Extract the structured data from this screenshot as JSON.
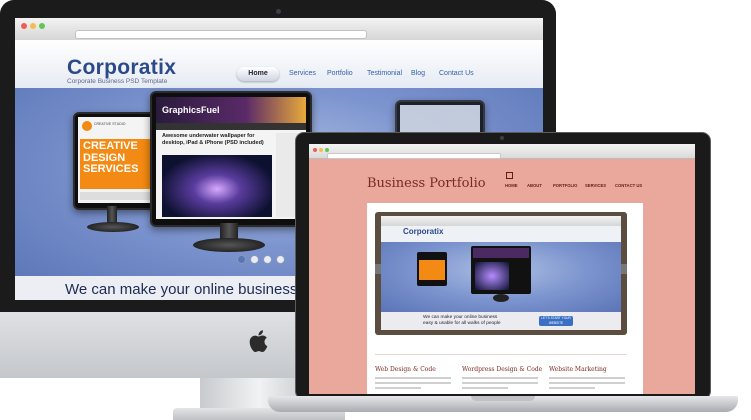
{
  "imac_site": {
    "logo": "Corporatix",
    "tagline": "Corporate Business PSD Template",
    "nav": [
      "Home",
      "Services",
      "Portfolio",
      "Testimonial",
      "Blog",
      "Contact Us"
    ],
    "active_nav": "Home",
    "hero_text": "We can make your online business",
    "left_monitor": {
      "badge": "CREATIVE STUDIO",
      "headline_1": "CREATIVE",
      "headline_2": "DESIGN",
      "headline_3": "SERVICES"
    },
    "center_monitor": {
      "brand": "GraphicsFuel",
      "article_title": "Awesome underwater wallpaper for desktop, iPad & iPhone (PSD included)"
    }
  },
  "laptop_site": {
    "title": "Business Portfolio",
    "nav": [
      "HOME",
      "ABOUT",
      "PORTFOLIO",
      "SERVICES",
      "CONTACT US"
    ],
    "preview_logo": "Corporatix",
    "preview_text_1": "We can make your online business",
    "preview_text_2": "easy & usable for all walks of people",
    "preview_button": "LET'S START YOUR WEBSITE",
    "columns": [
      {
        "heading": "Web Design & Code"
      },
      {
        "heading": "Wordpress Design & Code"
      },
      {
        "heading": "Website Marketing"
      }
    ]
  },
  "colors": {
    "logo_blue": "#2b4a8a",
    "hero_blue": "#7d95cf",
    "creative_orange": "#f28a13",
    "portfolio_pink": "#e9a89b",
    "portfolio_title": "#7a2a22"
  }
}
